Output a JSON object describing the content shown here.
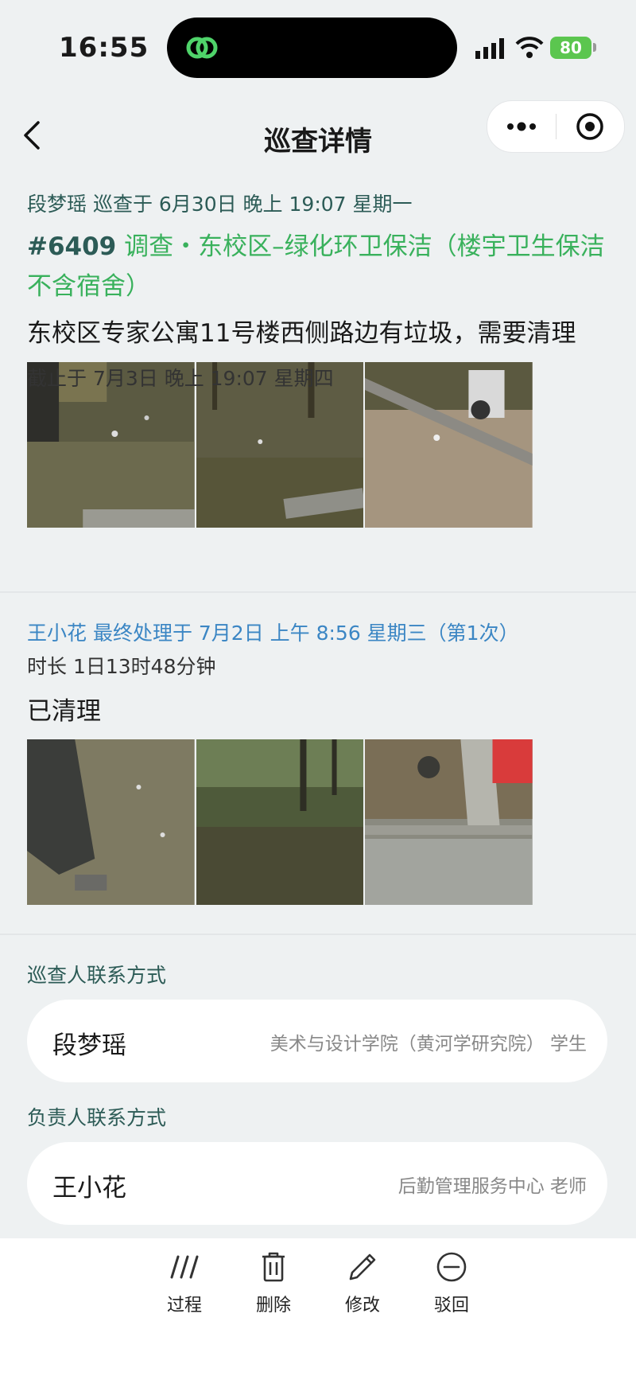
{
  "status_bar": {
    "time": "16:55",
    "battery": "80"
  },
  "nav": {
    "title": "巡查详情"
  },
  "inspection": {
    "meta": "段梦瑶  巡查于 6月30日 晚上 19:07 星期一",
    "number": "#6409",
    "category": "调查・东校区–绿化环卫保洁（楼宇卫生保洁 不含宿舍）",
    "description": "东校区专家公寓11号楼西侧路边有垃圾，需要清理",
    "deadline": "截止于 7月3日 晚上 19:07 星期四"
  },
  "handling": {
    "meta": "王小花  最终处理于 7月2日 上午 8:56 星期三（第1次）",
    "duration": "时长 1日13时48分钟",
    "result": "已清理"
  },
  "inspector_contact": {
    "label": "巡查人联系方式",
    "name": "段梦瑶",
    "org": "美术与设计学院（黄河学研究院） 学生"
  },
  "responsible_contact": {
    "label": "负责人联系方式",
    "name": "王小花",
    "org": "后勤管理服务中心 老师"
  },
  "actions": {
    "process": "过程",
    "delete": "删除",
    "edit": "修改",
    "reject": "驳回"
  },
  "colors": {
    "accent_green": "#39b15c",
    "label_teal": "#2c5b56",
    "handler_blue": "#3b86c4"
  }
}
